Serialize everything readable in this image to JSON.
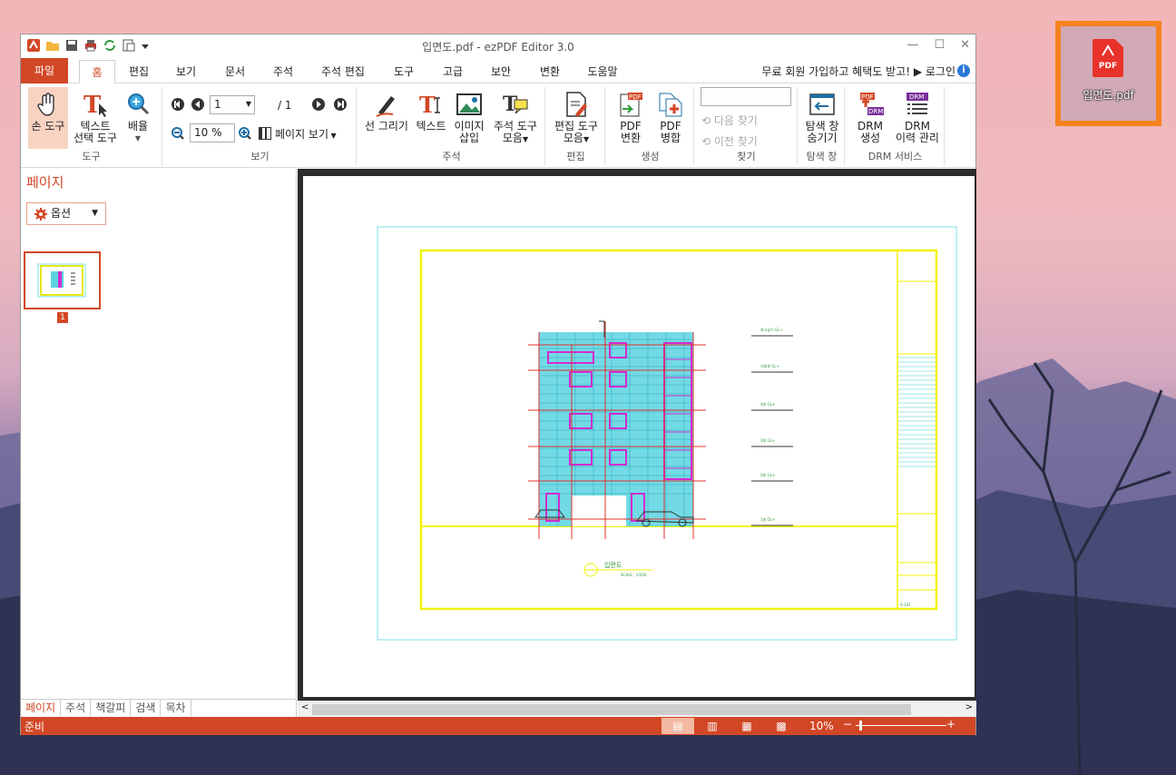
{
  "desktop": {
    "icon_label": "입면도.pdf",
    "icon_badge": "PDF"
  },
  "window": {
    "title": "입면도.pdf - ezPDF Editor 3.0",
    "controls": [
      "—",
      "☐",
      "✕"
    ]
  },
  "menu_tabs": [
    {
      "label": "파일"
    },
    {
      "label": "홈"
    },
    {
      "label": "편집"
    },
    {
      "label": "보기"
    },
    {
      "label": "문서"
    },
    {
      "label": "주석"
    },
    {
      "label": "주석 편집"
    },
    {
      "label": "도구"
    },
    {
      "label": "고급"
    },
    {
      "label": "보안"
    },
    {
      "label": "변환"
    },
    {
      "label": "도움말"
    }
  ],
  "promo": "무료 회원 가입하고 혜택도 받고! ▶ 로그인",
  "ribbon": {
    "tools": {
      "hand": "손 도구",
      "text_select_1": "텍스트",
      "text_select_2": "선택 도구",
      "zoom": "배율",
      "group": "도구"
    },
    "view": {
      "page_value": "1",
      "page_total": "/ 1",
      "zoom_value": "10 %",
      "page_view": "페이지 보기",
      "group": "보기"
    },
    "annot": {
      "line": "선 그리기",
      "text": "텍스트",
      "image_1": "이미지",
      "image_2": "삽입",
      "toolset_1": "주석 도구",
      "toolset_2": "모음",
      "group": "주석"
    },
    "edit": {
      "tool_1": "편집 도구",
      "tool_2": "모음",
      "group": "편집"
    },
    "create": {
      "convert_1": "PDF",
      "convert_2": "변환",
      "merge_1": "PDF",
      "merge_2": "병합",
      "group": "생성"
    },
    "find": {
      "next": "다음 찾기",
      "prev": "이전 찾기",
      "group": "찾기",
      "query": ""
    },
    "nav": {
      "hide_1": "탐색 창",
      "hide_2": "숨기기",
      "group": "탐색 창"
    },
    "drm": {
      "create_1": "DRM",
      "create_2": "생성",
      "history_1": "DRM",
      "history_2": "이력 관리",
      "group": "DRM 서비스"
    }
  },
  "left_panel": {
    "title": "페이지",
    "options": "옵션",
    "thumb_number": "1",
    "bottom_tabs": [
      "페이지",
      "주석",
      "책갈피",
      "검색",
      "목차"
    ]
  },
  "drawing": {
    "title": "입면도",
    "scale": "SCALE : 1/100",
    "level_labels": [
      "최고높이 GL+",
      "지붕층 GL+",
      "4층 GL+",
      "3층 GL+",
      "2층 GL+",
      "1층 GL+"
    ],
    "sheet_no": "A-101"
  },
  "status": {
    "ready": "준비",
    "zoom": "10%",
    "minus": "−",
    "plus": "+"
  }
}
